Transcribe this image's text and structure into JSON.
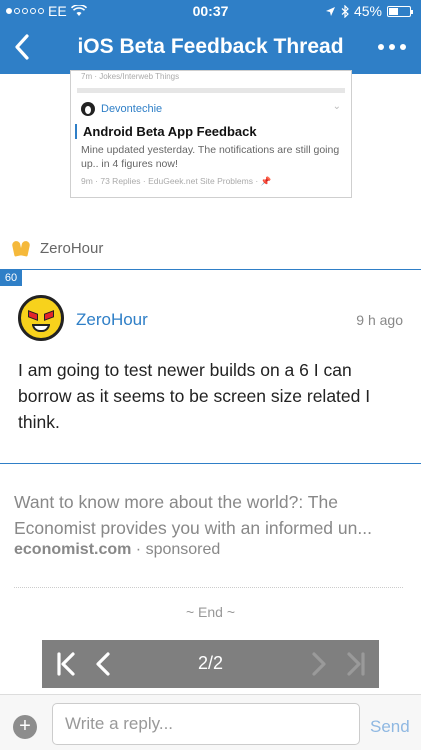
{
  "status_bar": {
    "carrier": "EE",
    "time": "00:37",
    "battery": "45%",
    "battery_level": 0.45
  },
  "nav": {
    "title": "iOS Beta Feedback Thread",
    "back_icon": "chevron-left-icon",
    "more_icon": "ellipsis-icon"
  },
  "preview_card": {
    "prev_meta": "7m · Jokes/Interweb Things",
    "author": "Devontechie",
    "thread_title": "Android Beta App Feedback",
    "snippet": "Mine updated yesterday. The notifications are still going up.. in 4 figures now!",
    "meta": "9m · 73 Replies · EduGeek.net Site Problems ·"
  },
  "reaction": {
    "user": "ZeroHour"
  },
  "post": {
    "number": "60",
    "author": "ZeroHour",
    "time": "9 h ago",
    "body": "I am going to test newer builds on a 6 I can borrow as it seems to be screen size related I think."
  },
  "sponsored": {
    "title": "Want to know more about the world?: The Economist provides you with an informed un...",
    "source": "economist.com",
    "separator": " · ",
    "label": "sponsored"
  },
  "end_label": "~ End ~",
  "pager": {
    "page": "2/2"
  },
  "reply": {
    "placeholder": "Write a reply...",
    "send_label": "Send",
    "add_label": "+"
  },
  "colors": {
    "accent": "#2f7fc7",
    "pager_bg": "#7f7f7f",
    "send_disabled": "#8fb8e2"
  }
}
